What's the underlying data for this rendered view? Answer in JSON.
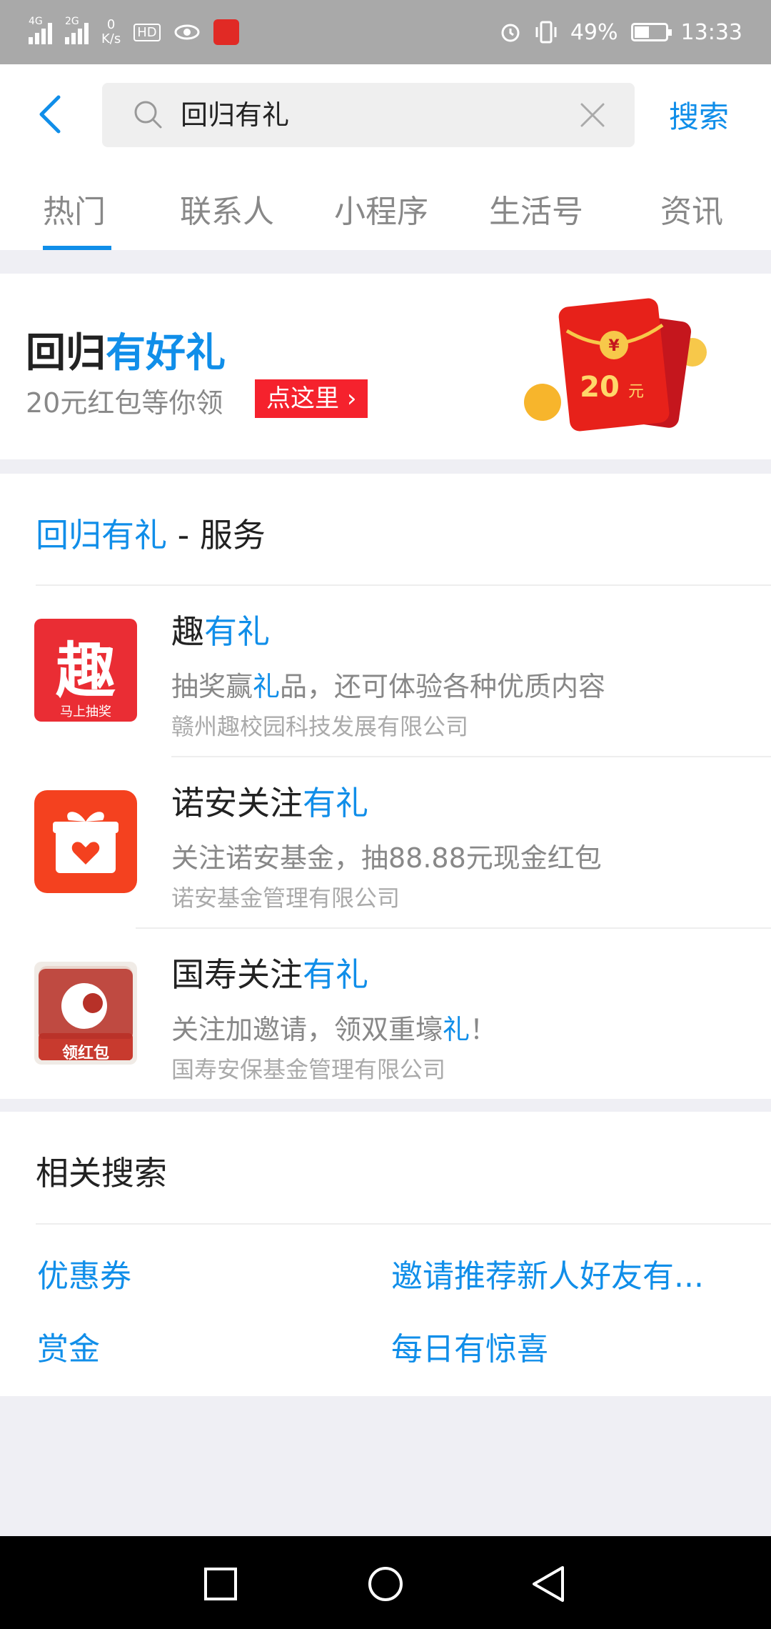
{
  "status_bar": {
    "sig1_label": "4G",
    "sig2_label": "2G",
    "net_speed": "0",
    "net_unit": "K/s",
    "hd": "HD",
    "battery": "49%",
    "time": "13:33",
    "battery_level": 0.49
  },
  "search": {
    "query": "回归有礼",
    "search_label": "搜索"
  },
  "tabs": [
    "热门",
    "联系人",
    "小程序",
    "生活号",
    "资讯"
  ],
  "promo": {
    "title_plain": "回归",
    "title_highlight": "有好礼",
    "subtitle": "20元红包等你领",
    "button_label": "点这里",
    "packet_amount": "20",
    "packet_unit": "元",
    "packet_coin": "¥"
  },
  "services": {
    "heading_highlight": "回归有礼",
    "heading_rest": " - 服务",
    "items": [
      {
        "name_plain": "趣",
        "name_highlight": "有礼",
        "desc_a": "抽奖赢",
        "desc_hl": "礼",
        "desc_b": "品，还可体验各种优质内容",
        "org": "赣州趣校园科技发展有限公司",
        "icon_char": "趣",
        "icon_caption": "马上抽奖"
      },
      {
        "name_plain": "诺安关注",
        "name_highlight": "有礼",
        "desc_a": "关注诺安基金，抽88.88元现金红包",
        "desc_hl": "",
        "desc_b": "",
        "org": "诺安基金管理有限公司"
      },
      {
        "name_plain": "国寿关注",
        "name_highlight": "有礼",
        "desc_a": "关注加邀请，领双重壕",
        "desc_hl": "礼",
        "desc_b": "！",
        "org": "国寿安保基金管理有限公司",
        "icon_caption": "领红包"
      }
    ]
  },
  "related": {
    "title": "相关搜索",
    "links": [
      "优惠券",
      "邀请推荐新人好友有...",
      "赏金",
      "每日有惊喜"
    ]
  },
  "colors": {
    "accent": "#108ee9",
    "red": "#f5222d"
  }
}
